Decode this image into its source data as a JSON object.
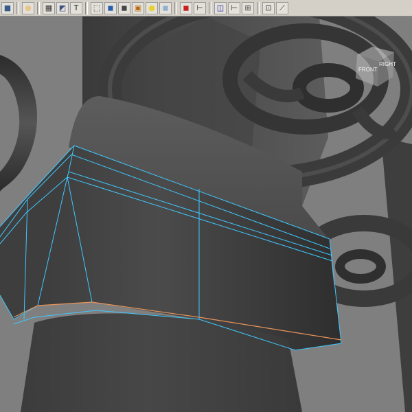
{
  "toolbar": {
    "icons": [
      {
        "name": "select-mode-icon",
        "glyph": "■",
        "tint": "#3a5a8a"
      },
      {
        "name": "sphere-icon",
        "glyph": "●",
        "tint": "#e8c58a"
      },
      {
        "name": "wireframe-icon",
        "glyph": "▦",
        "tint": "#333333"
      },
      {
        "name": "uv-editor-icon",
        "glyph": "◩",
        "tint": "#405080"
      },
      {
        "name": "text-tool-icon",
        "glyph": "T",
        "tint": "#222222"
      },
      {
        "name": "wire-cube-icon",
        "glyph": "⬚",
        "tint": "#333333"
      },
      {
        "name": "shaded-cube-icon",
        "glyph": "◼",
        "tint": "#2a5fb0"
      },
      {
        "name": "smooth-shade-icon",
        "glyph": "◼",
        "tint": "#444444"
      },
      {
        "name": "textured-icon",
        "glyph": "▣",
        "tint": "#b8650e"
      },
      {
        "name": "light-bulb-icon",
        "glyph": "●",
        "tint": "#e8d030"
      },
      {
        "name": "xray-cube-icon",
        "glyph": "◼",
        "tint": "#8fb0d0"
      },
      {
        "name": "red-cube-icon",
        "glyph": "◼",
        "tint": "#c81e1e"
      },
      {
        "name": "axis-tool-icon",
        "glyph": "⊢",
        "tint": "#333333"
      },
      {
        "name": "frame-select-icon",
        "glyph": "◫",
        "tint": "#2020a0"
      },
      {
        "name": "isolate-icon",
        "glyph": "⊢",
        "tint": "#333333"
      },
      {
        "name": "grid-icon",
        "glyph": "⊞",
        "tint": "#444444"
      },
      {
        "name": "resolution-gate-icon",
        "glyph": "⊡",
        "tint": "#333333"
      },
      {
        "name": "joint-tool-icon",
        "glyph": "⟋",
        "tint": "#333333"
      }
    ]
  },
  "viewcube": {
    "front_label": "FRONT",
    "right_label": "RIGHT"
  },
  "viewport": {
    "background": "#7f7f7f",
    "wire_color": "#40c8ff",
    "edge_highlight_color": "#e8945a"
  }
}
